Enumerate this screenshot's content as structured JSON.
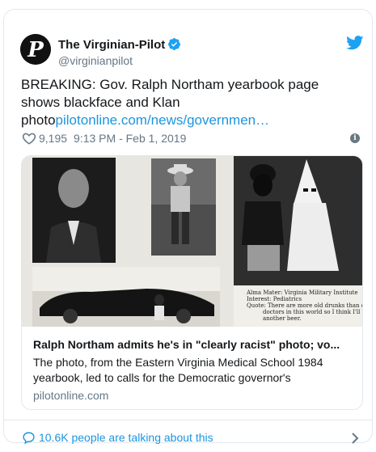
{
  "tweet": {
    "author_name": "The Virginian-Pilot",
    "author_handle": "@virginianpilot",
    "avatar_letter": "P",
    "text_main": "BREAKING: Gov. Ralph Northam yearbook page shows blackface and Klan photo",
    "text_link": "pilotonline.com/news/governmen…",
    "likes": "9,195",
    "timestamp": "9:13 PM - Feb 1, 2019",
    "info_label": "i"
  },
  "link_card": {
    "title": "Ralph Northam admits he's in \"clearly racist\" photo; vo...",
    "description": "The photo, from the Eastern Virginia Medical School 1984 yearbook, led to calls for the Democratic governor's",
    "domain": "pilotonline.com",
    "photo_caption_lines": [
      "Alma Mater: Virginia Military Institute",
      "Interest: Pediatrics",
      "Quote: There are more old drunks than old",
      "doctors in this world so I think I'll have",
      "another beer."
    ]
  },
  "footer": {
    "talking_text": "10.6K people are talking about this"
  },
  "colors": {
    "link_blue": "#1b95e0",
    "twitter_blue": "#1da1f2",
    "muted_gray": "#657786",
    "border": "#e1e8ed"
  },
  "icons": [
    "verified-badge-icon",
    "twitter-bird-icon",
    "heart-icon",
    "info-icon",
    "speech-bubble-icon",
    "chevron-right-icon"
  ]
}
